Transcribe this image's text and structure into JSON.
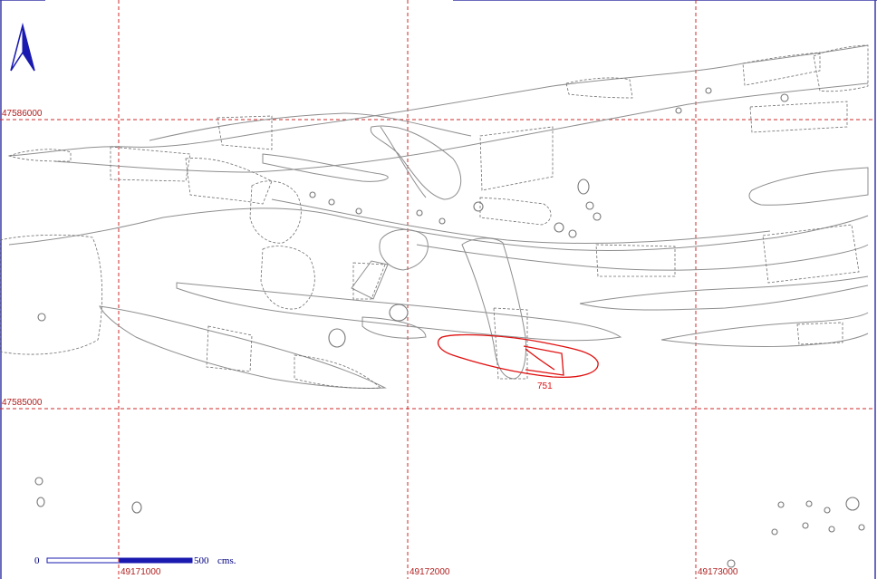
{
  "north_arrow": {
    "icon": "north-arrow-icon",
    "color": "#1a1ab0"
  },
  "grid_color": "#cc2a2a",
  "grid_labels": {
    "northing_top": "47586000",
    "northing_bottom": "47585000",
    "easting_1": "49171000",
    "easting_2": "49172000",
    "easting_3": "49173000"
  },
  "highlighted_feature": {
    "label": "751",
    "color": "#e01010"
  },
  "scale_bar": {
    "start": "0",
    "end": "500",
    "unit": "cms.",
    "color": "#1a1ab0"
  }
}
